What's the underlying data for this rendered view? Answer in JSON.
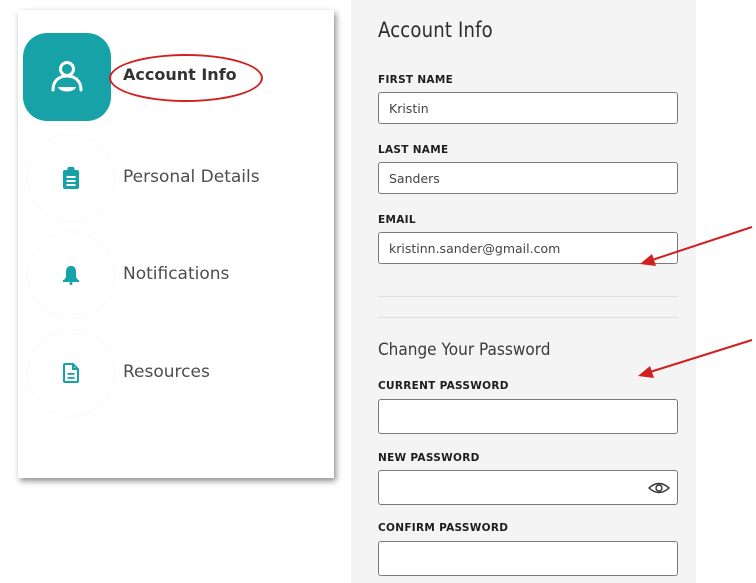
{
  "sidebar": {
    "items": [
      {
        "label": "Account Info",
        "icon": "user-icon",
        "active": true
      },
      {
        "label": "Personal Details",
        "icon": "clipboard-icon",
        "active": false
      },
      {
        "label": "Notifications",
        "icon": "bell-icon",
        "active": false
      },
      {
        "label": "Resources",
        "icon": "document-icon",
        "active": false
      }
    ]
  },
  "account": {
    "title": "Account Info",
    "first_name": {
      "label": "FIRST NAME",
      "value": "Kristin"
    },
    "last_name": {
      "label": "LAST NAME",
      "value": "Sanders"
    },
    "email": {
      "label": "EMAIL",
      "value": "kristinn.sander@gmail.com"
    }
  },
  "password": {
    "title": "Change Your Password",
    "current": {
      "label": "CURRENT PASSWORD",
      "value": ""
    },
    "new": {
      "label": "NEW PASSWORD",
      "value": ""
    },
    "confirm": {
      "label": "CONFIRM PASSWORD",
      "value": ""
    }
  },
  "colors": {
    "accent": "#16a2a7",
    "annotation": "#d21f1f"
  }
}
